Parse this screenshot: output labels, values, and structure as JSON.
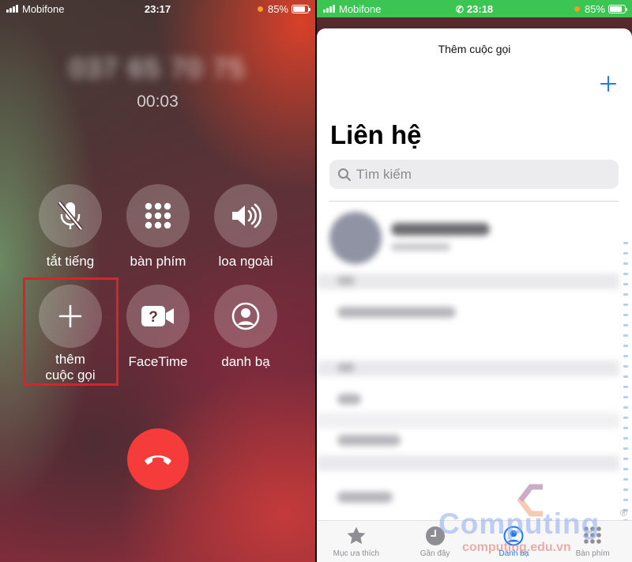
{
  "left_screen": {
    "status": {
      "carrier": "Mobifone",
      "time": "23:17",
      "battery": "85%"
    },
    "caller_number": "037 65 70 75",
    "timer": "00:03",
    "buttons": [
      {
        "label": "tắt tiếng",
        "icon": "mic-off-icon"
      },
      {
        "label": "bàn phím",
        "icon": "keypad-icon"
      },
      {
        "label": "loa ngoài",
        "icon": "speaker-icon"
      },
      {
        "label": "thêm\ncuộc gọi",
        "icon": "plus-icon",
        "highlighted": true
      },
      {
        "label": "FaceTime",
        "icon": "facetime-icon"
      },
      {
        "label": "danh bạ",
        "icon": "contacts-icon"
      }
    ],
    "end_call_icon": "phone-hangup-icon",
    "highlight_color": "#d7242c",
    "end_call_color": "#f63b3b"
  },
  "right_screen": {
    "status": {
      "carrier": "Mobifone",
      "time": "23:18",
      "battery": "85%",
      "bar_color": "#3cc553"
    },
    "sheet_title": "Thêm cuộc gọi",
    "add_icon": "plus-icon",
    "heading": "Liên hệ",
    "search_placeholder": "Tìm kiếm",
    "my_card": {
      "name": "Huy Nguyễn",
      "subtitle": "Thẻ của tôi"
    },
    "accent_color": "#1a7cf5",
    "tabs": [
      {
        "label": "Mục ưa thích",
        "icon": "star-icon",
        "active": false
      },
      {
        "label": "Gần đây",
        "icon": "clock-icon",
        "active": false
      },
      {
        "label": "Danh bạ",
        "icon": "contacts-icon",
        "active": true
      },
      {
        "label": "Bàn phím",
        "icon": "keypad-icon",
        "active": false
      }
    ]
  },
  "watermark": {
    "brand": "Computing",
    "site": "computing.edu.vn",
    "mark": "®"
  }
}
